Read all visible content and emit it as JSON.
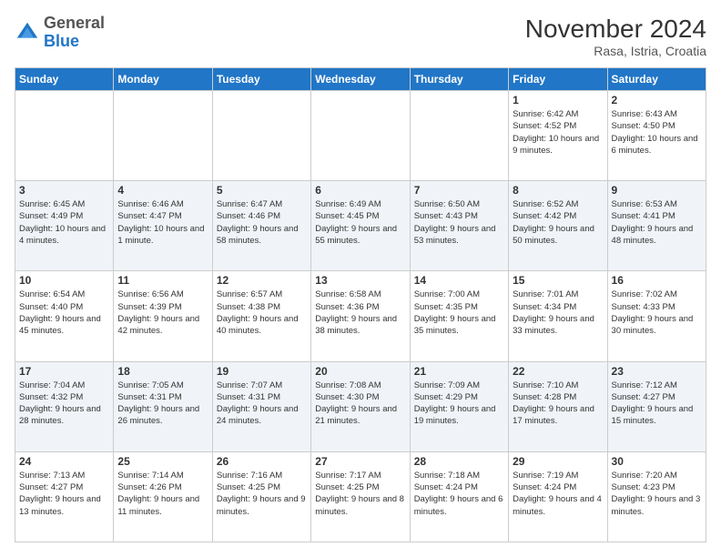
{
  "logo": {
    "general": "General",
    "blue": "Blue"
  },
  "header": {
    "month": "November 2024",
    "location": "Rasa, Istria, Croatia"
  },
  "weekdays": [
    "Sunday",
    "Monday",
    "Tuesday",
    "Wednesday",
    "Thursday",
    "Friday",
    "Saturday"
  ],
  "weeks": [
    [
      {
        "day": "",
        "info": ""
      },
      {
        "day": "",
        "info": ""
      },
      {
        "day": "",
        "info": ""
      },
      {
        "day": "",
        "info": ""
      },
      {
        "day": "",
        "info": ""
      },
      {
        "day": "1",
        "info": "Sunrise: 6:42 AM\nSunset: 4:52 PM\nDaylight: 10 hours and 9 minutes."
      },
      {
        "day": "2",
        "info": "Sunrise: 6:43 AM\nSunset: 4:50 PM\nDaylight: 10 hours and 6 minutes."
      }
    ],
    [
      {
        "day": "3",
        "info": "Sunrise: 6:45 AM\nSunset: 4:49 PM\nDaylight: 10 hours and 4 minutes."
      },
      {
        "day": "4",
        "info": "Sunrise: 6:46 AM\nSunset: 4:47 PM\nDaylight: 10 hours and 1 minute."
      },
      {
        "day": "5",
        "info": "Sunrise: 6:47 AM\nSunset: 4:46 PM\nDaylight: 9 hours and 58 minutes."
      },
      {
        "day": "6",
        "info": "Sunrise: 6:49 AM\nSunset: 4:45 PM\nDaylight: 9 hours and 55 minutes."
      },
      {
        "day": "7",
        "info": "Sunrise: 6:50 AM\nSunset: 4:43 PM\nDaylight: 9 hours and 53 minutes."
      },
      {
        "day": "8",
        "info": "Sunrise: 6:52 AM\nSunset: 4:42 PM\nDaylight: 9 hours and 50 minutes."
      },
      {
        "day": "9",
        "info": "Sunrise: 6:53 AM\nSunset: 4:41 PM\nDaylight: 9 hours and 48 minutes."
      }
    ],
    [
      {
        "day": "10",
        "info": "Sunrise: 6:54 AM\nSunset: 4:40 PM\nDaylight: 9 hours and 45 minutes."
      },
      {
        "day": "11",
        "info": "Sunrise: 6:56 AM\nSunset: 4:39 PM\nDaylight: 9 hours and 42 minutes."
      },
      {
        "day": "12",
        "info": "Sunrise: 6:57 AM\nSunset: 4:38 PM\nDaylight: 9 hours and 40 minutes."
      },
      {
        "day": "13",
        "info": "Sunrise: 6:58 AM\nSunset: 4:36 PM\nDaylight: 9 hours and 38 minutes."
      },
      {
        "day": "14",
        "info": "Sunrise: 7:00 AM\nSunset: 4:35 PM\nDaylight: 9 hours and 35 minutes."
      },
      {
        "day": "15",
        "info": "Sunrise: 7:01 AM\nSunset: 4:34 PM\nDaylight: 9 hours and 33 minutes."
      },
      {
        "day": "16",
        "info": "Sunrise: 7:02 AM\nSunset: 4:33 PM\nDaylight: 9 hours and 30 minutes."
      }
    ],
    [
      {
        "day": "17",
        "info": "Sunrise: 7:04 AM\nSunset: 4:32 PM\nDaylight: 9 hours and 28 minutes."
      },
      {
        "day": "18",
        "info": "Sunrise: 7:05 AM\nSunset: 4:31 PM\nDaylight: 9 hours and 26 minutes."
      },
      {
        "day": "19",
        "info": "Sunrise: 7:07 AM\nSunset: 4:31 PM\nDaylight: 9 hours and 24 minutes."
      },
      {
        "day": "20",
        "info": "Sunrise: 7:08 AM\nSunset: 4:30 PM\nDaylight: 9 hours and 21 minutes."
      },
      {
        "day": "21",
        "info": "Sunrise: 7:09 AM\nSunset: 4:29 PM\nDaylight: 9 hours and 19 minutes."
      },
      {
        "day": "22",
        "info": "Sunrise: 7:10 AM\nSunset: 4:28 PM\nDaylight: 9 hours and 17 minutes."
      },
      {
        "day": "23",
        "info": "Sunrise: 7:12 AM\nSunset: 4:27 PM\nDaylight: 9 hours and 15 minutes."
      }
    ],
    [
      {
        "day": "24",
        "info": "Sunrise: 7:13 AM\nSunset: 4:27 PM\nDaylight: 9 hours and 13 minutes."
      },
      {
        "day": "25",
        "info": "Sunrise: 7:14 AM\nSunset: 4:26 PM\nDaylight: 9 hours and 11 minutes."
      },
      {
        "day": "26",
        "info": "Sunrise: 7:16 AM\nSunset: 4:25 PM\nDaylight: 9 hours and 9 minutes."
      },
      {
        "day": "27",
        "info": "Sunrise: 7:17 AM\nSunset: 4:25 PM\nDaylight: 9 hours and 8 minutes."
      },
      {
        "day": "28",
        "info": "Sunrise: 7:18 AM\nSunset: 4:24 PM\nDaylight: 9 hours and 6 minutes."
      },
      {
        "day": "29",
        "info": "Sunrise: 7:19 AM\nSunset: 4:24 PM\nDaylight: 9 hours and 4 minutes."
      },
      {
        "day": "30",
        "info": "Sunrise: 7:20 AM\nSunset: 4:23 PM\nDaylight: 9 hours and 3 minutes."
      }
    ]
  ]
}
